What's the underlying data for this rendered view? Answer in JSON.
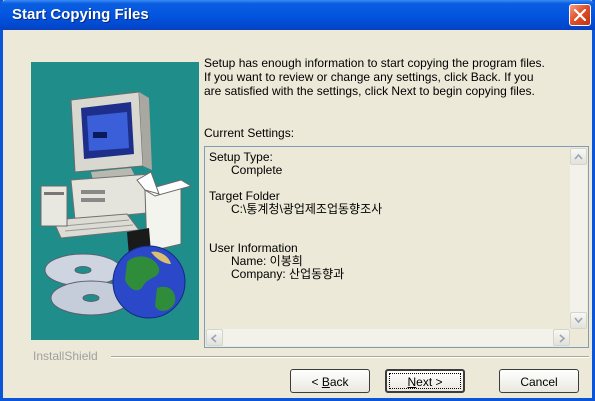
{
  "window": {
    "title": "Start Copying Files"
  },
  "intro": {
    "line1": "Setup has enough information to start copying the program files.",
    "line2": "If you want to review or change any settings, click Back.  If you",
    "line3": "are satisfied with the settings, click Next to begin copying files."
  },
  "current_settings_label": "Current Settings:",
  "settings": {
    "setup_type_label": "Setup Type:",
    "setup_type_value": "Complete",
    "target_folder_label": "Target Folder",
    "target_folder_value": "C:\\통계청\\광업제조업동향조사",
    "user_info_label": "User Information",
    "name_line": "Name:  이봉희",
    "company_line": "Company:  산업동향과"
  },
  "footer": {
    "brand": "InstallShield"
  },
  "buttons": {
    "back_mnemonic": "B",
    "back_rest": "ack",
    "back_prefix": "< ",
    "next_mnemonic": "N",
    "next_rest": "ext >",
    "cancel": "Cancel"
  },
  "colors": {
    "titlebar": "#0355e0",
    "dialog_bg": "#ece9d8",
    "illustration_bg": "#1f8d8a"
  },
  "icons": {
    "close": "close-icon",
    "illustration": "computer-box-cd-globe-illustration"
  }
}
